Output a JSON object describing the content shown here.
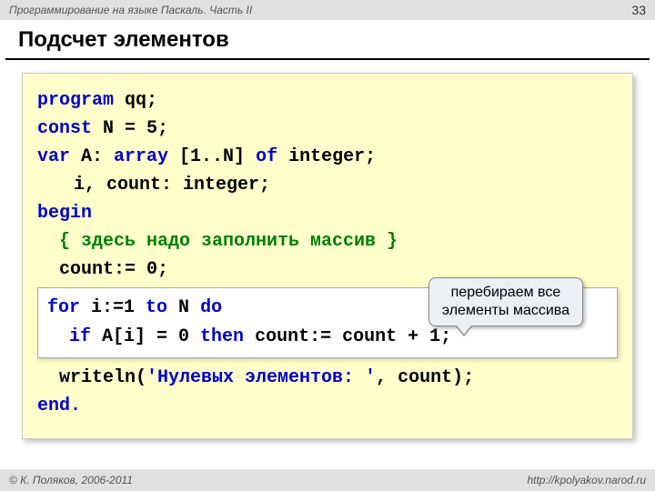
{
  "header": {
    "course": "Программирование на языке Паскаль. Часть II",
    "page": "33"
  },
  "title": "Подсчет элементов",
  "code": {
    "l1a": "program",
    "l1b": " qq;",
    "l2a": "const",
    "l2b": " N = 5;",
    "l3a": "var",
    "l3b": " A: ",
    "l3c": "array",
    "l3d": " [1..N] ",
    "l3e": "of",
    "l3f": " integer;",
    "l4": "i, count: integer;",
    "l5": "begin",
    "comment": "{ здесь надо заполнить массив }",
    "l6": "count:= 0;",
    "loop1a": "for",
    "loop1b": " i:=1 ",
    "loop1c": "to",
    "loop1d": " N ",
    "loop1e": "do",
    "loop2a": "if",
    "loop2b": " A[i] = 0 ",
    "loop2c": "then",
    "loop2d": " count:= count + 1;",
    "l7a": "writeln(",
    "l7b": "'Нулевых элементов: '",
    "l7c": ", count);",
    "l8": "end."
  },
  "callout": "перебираем все\nэлементы массива",
  "footer": {
    "copyright": "© К. Поляков, 2006-2011",
    "url": "http://kpolyakov.narod.ru"
  }
}
